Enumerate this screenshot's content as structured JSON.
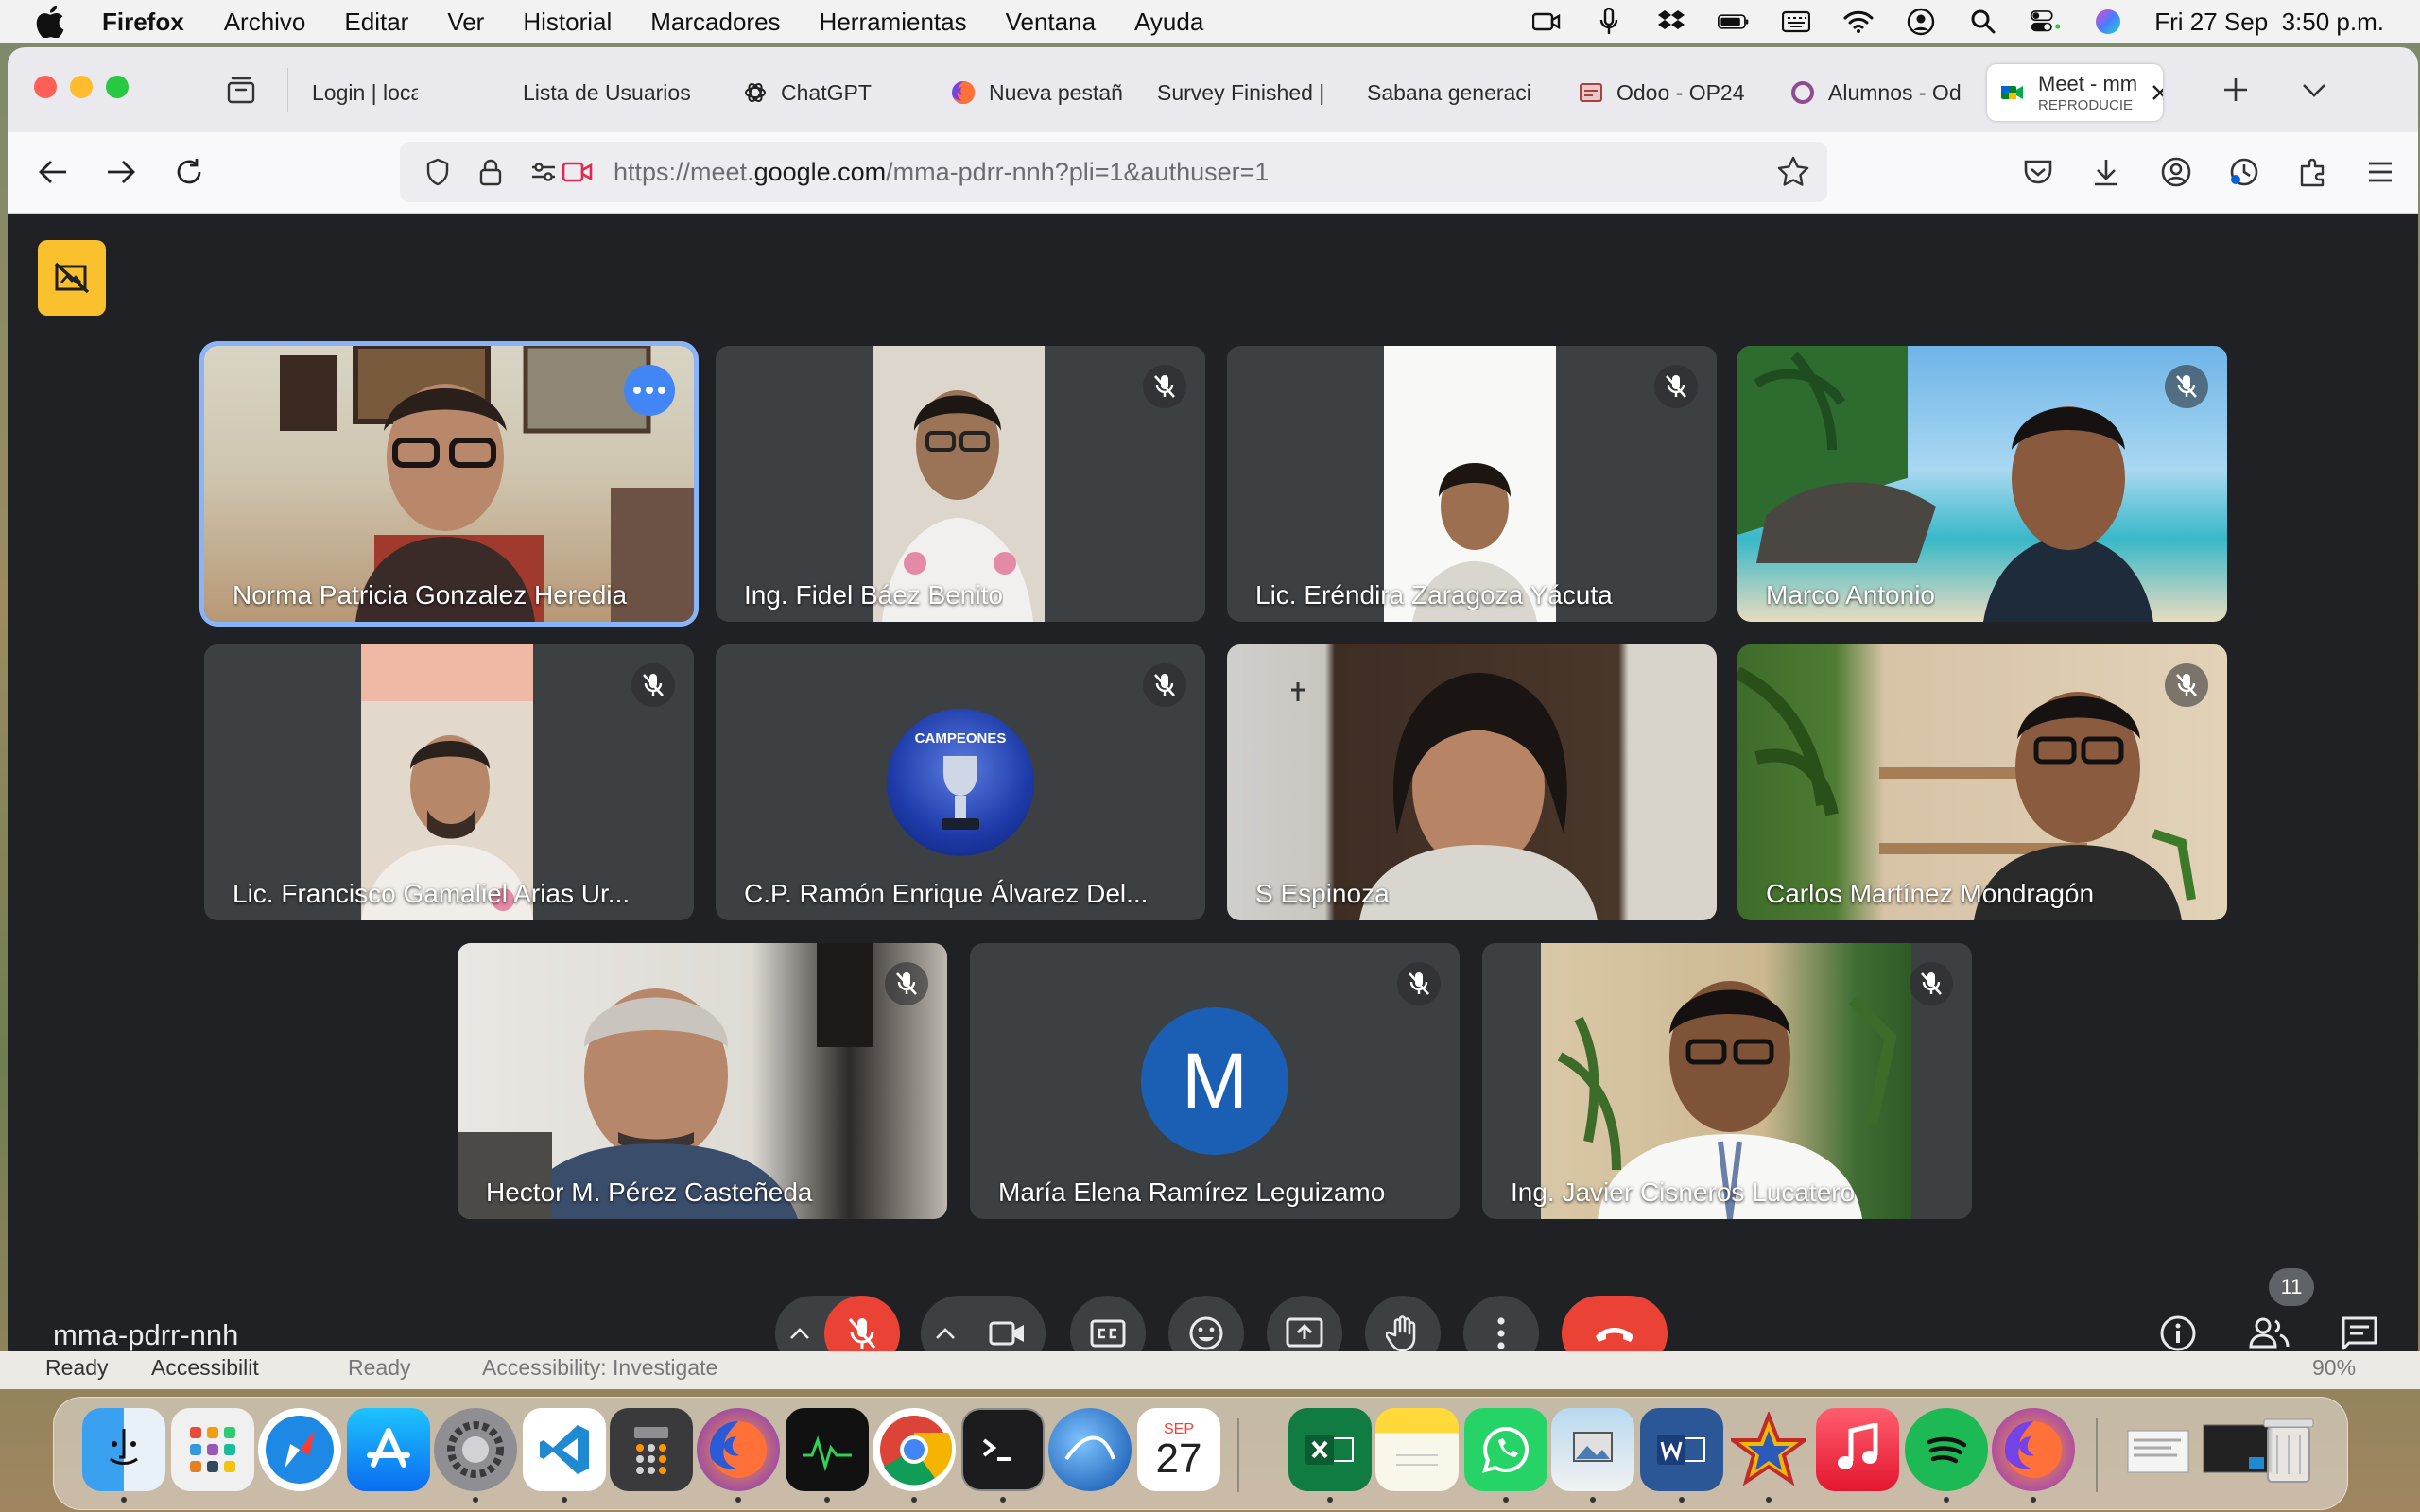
{
  "menubar": {
    "items": [
      "Firefox",
      "Archivo",
      "Editar",
      "Ver",
      "Historial",
      "Marcadores",
      "Herramientas",
      "Ventana",
      "Ayuda"
    ],
    "clock": "Fri 27 Sep  3:50 p.m."
  },
  "tabs": [
    {
      "title": "Login | localhost",
      "icon": "none"
    },
    {
      "title": "Lista de Usuarios",
      "icon": "none"
    },
    {
      "title": "ChatGPT",
      "icon": "chatgpt-icon"
    },
    {
      "title": "Nueva pestañ",
      "icon": "firefox-icon"
    },
    {
      "title": "Survey Finished |",
      "icon": "none"
    },
    {
      "title": "Sabana generaci",
      "icon": "none"
    },
    {
      "title": "Odoo - OP24",
      "icon": "odoo-icon"
    },
    {
      "title": "Alumnos - Od",
      "icon": "odoo-circle-icon"
    }
  ],
  "active_tab": {
    "title": "Meet - mm",
    "subtitle": "REPRODUCIE"
  },
  "url": {
    "prefix": "https://meet.",
    "domain": "google.com",
    "path": "/mma-pdrr-nnh?pli=1&authuser=1"
  },
  "meeting": {
    "code": "mma-pdrr-nnh",
    "participant_count": "11"
  },
  "participants": [
    {
      "name": "Norma Patricia Gonzalez Heredia",
      "muted": false,
      "speaking": true,
      "avatar": "video"
    },
    {
      "name": "Ing. Fidel Báez Benito",
      "muted": true,
      "avatar": "video"
    },
    {
      "name": "Lic. Eréndira Zaragoza Yácuta",
      "muted": true,
      "avatar": "video"
    },
    {
      "name": "Marco Antonio",
      "muted": true,
      "avatar": "video-beach"
    },
    {
      "name": "Lic. Francisco Gamaliel Arias Ur...",
      "muted": true,
      "avatar": "video"
    },
    {
      "name": "C.P. Ramón Enrique Álvarez Del...",
      "muted": true,
      "avatar": "logo",
      "logo_text": "CAMPEONES"
    },
    {
      "name": "S Espinoza",
      "muted": false,
      "avatar": "video"
    },
    {
      "name": "Carlos Martínez Mondragón",
      "muted": true,
      "avatar": "video"
    },
    {
      "name": "Hector M. Pérez Casteñeda",
      "muted": true,
      "avatar": "video"
    },
    {
      "name": "María Elena Ramírez Leguizamo",
      "muted": true,
      "avatar": "letter",
      "letter": "M"
    },
    {
      "name": "Ing. Javier Cisneros Lucatero",
      "muted": true,
      "avatar": "video"
    }
  ],
  "behind_window": {
    "status_left": "Ready",
    "status_left2": "Ready",
    "accessibility": "Accessibilit",
    "accessibility2": "Accessibility: Investigate",
    "zoom": "90%"
  },
  "dock": {
    "calendar_month": "SEP",
    "calendar_day": "27"
  },
  "colors": {
    "speaking_border": "#8ab4f8",
    "end_call": "#ea4335",
    "meet_bg": "#202124",
    "tile_bg": "#3c4043"
  }
}
